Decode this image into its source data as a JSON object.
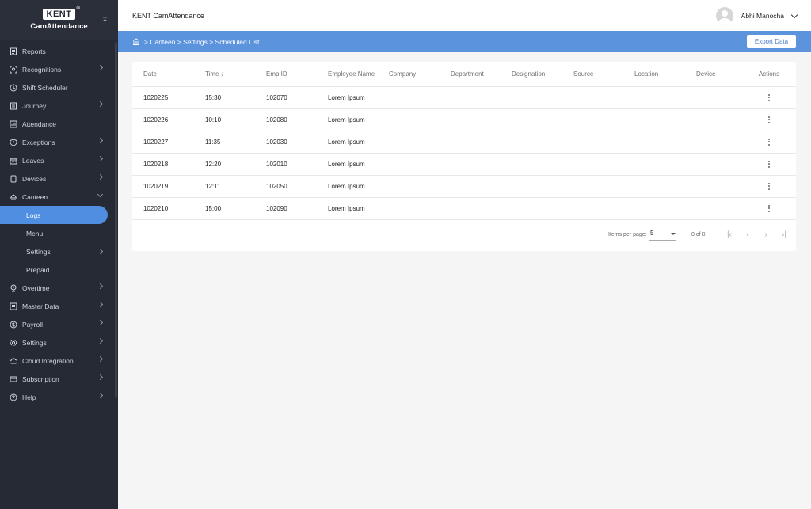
{
  "brand": {
    "logo_text": "KENT",
    "trademark": "®",
    "app_name": "CamAttendance"
  },
  "topbar": {
    "title": "KENT CamAttendance",
    "user_name": "Abhi Manocha"
  },
  "sidebar": {
    "items": [
      {
        "label": "Reports",
        "icon": "reports-icon",
        "chevron": false
      },
      {
        "label": "Recognitions",
        "icon": "recognition-icon",
        "chevron": true
      },
      {
        "label": "Shift Scheduler",
        "icon": "clock-icon",
        "chevron": false
      },
      {
        "label": "Journey",
        "icon": "journey-icon",
        "chevron": true
      },
      {
        "label": "Attendance",
        "icon": "attendance-icon",
        "chevron": false
      },
      {
        "label": "Exceptions",
        "icon": "shield-icon",
        "chevron": true
      },
      {
        "label": "Leaves",
        "icon": "calendar-icon",
        "chevron": true
      },
      {
        "label": "Devices",
        "icon": "device-icon",
        "chevron": true
      },
      {
        "label": "Canteen",
        "icon": "canteen-icon",
        "chevron": true,
        "expanded": true
      }
    ],
    "canteen_sub": [
      {
        "label": "Logs",
        "active": true,
        "chevron": false
      },
      {
        "label": "Menu",
        "active": false,
        "chevron": false
      },
      {
        "label": "Settings",
        "active": false,
        "chevron": true
      },
      {
        "label": "Prepaid",
        "active": false,
        "chevron": false
      }
    ],
    "items_after": [
      {
        "label": "Overtime",
        "icon": "overtime-icon",
        "chevron": true
      },
      {
        "label": "Master Data",
        "icon": "master-data-icon",
        "chevron": true
      },
      {
        "label": "Payroll",
        "icon": "payroll-icon",
        "chevron": true
      },
      {
        "label": "Settings",
        "icon": "gear-icon",
        "chevron": true
      },
      {
        "label": "Cloud Integration",
        "icon": "cloud-icon",
        "chevron": true
      },
      {
        "label": "Subscription",
        "icon": "card-icon",
        "chevron": true
      },
      {
        "label": "Help",
        "icon": "help-icon",
        "chevron": true
      }
    ]
  },
  "breadcrumb": {
    "text": "> Canteen > Settings > Scheduled List"
  },
  "actions": {
    "export_label": "Export Data"
  },
  "table": {
    "columns": [
      "Date",
      "Time",
      "Emp ID",
      "Employee Name",
      "Company",
      "Department",
      "Designation",
      "Source",
      "Location",
      "Device",
      "Actions"
    ],
    "sort_indicator": "↓",
    "rows": [
      [
        "1020225",
        "15:30",
        "102070",
        "Lorem Ipsum",
        "",
        "",
        "",
        "",
        "",
        ""
      ],
      [
        "1020226",
        "10:10",
        "102080",
        "Lorem Ipsum",
        "",
        "",
        "",
        "",
        "",
        ""
      ],
      [
        "1020227",
        "11:35",
        "102030",
        "Lorem Ipsum",
        "",
        "",
        "",
        "",
        "",
        ""
      ],
      [
        "1020218",
        "12:20",
        "102010",
        "Lorem Ipsum",
        "",
        "",
        "",
        "",
        "",
        ""
      ],
      [
        "1020219",
        "12:11",
        "102050",
        "Lorem Ipsum",
        "",
        "",
        "",
        "",
        "",
        ""
      ],
      [
        "1020210",
        "15:00",
        "102090",
        "Lorem Ipsum",
        "",
        "",
        "",
        "",
        "",
        ""
      ]
    ]
  },
  "pagination": {
    "items_per_page_label": "Items per page:",
    "items_per_page": "5",
    "range": "0 of 0"
  },
  "colors": {
    "accent": "#5b93dd",
    "active_nav": "#4f8ee0",
    "sidebar_bg": "#262a34"
  }
}
